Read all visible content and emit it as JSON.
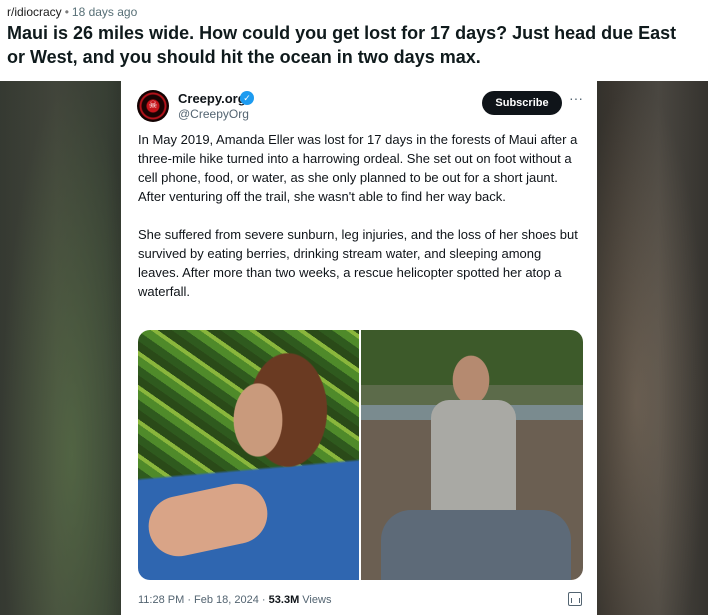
{
  "post": {
    "subreddit": "r/idiocracy",
    "separator": "•",
    "age": "18 days ago",
    "title": "Maui is 26 miles wide. How could you get lost for 17 days? Just head due East or West, and you should hit the ocean in two days max."
  },
  "tweet": {
    "display_name": "Creepy.org",
    "verified_icon": "verified-badge-icon",
    "handle": "@CreepyOrg",
    "subscribe_label": "Subscribe",
    "more_label": "···",
    "paragraphs": [
      "In May 2019, Amanda Eller was lost for 17 days in the forests of Maui after a three-mile hike turned into a harrowing ordeal. She set out on foot without a cell phone, food, or water, as she only planned to be out for a short jaunt. After venturing off the trail, she wasn't able to find her way back.",
      "She suffered from severe sunburn, leg injuries, and the loss of her shoes but survived by eating berries, drinking stream water, and sleeping among leaves. After more than two weeks, a rescue helicopter spotted her atop a waterfall."
    ],
    "photos": [
      "photo-before",
      "photo-after"
    ],
    "timestamp": "11:28 PM · Feb 18, 2024 ·",
    "views_count": "53.3M",
    "views_label": "Views",
    "accent_color": "#1d9bf0"
  }
}
